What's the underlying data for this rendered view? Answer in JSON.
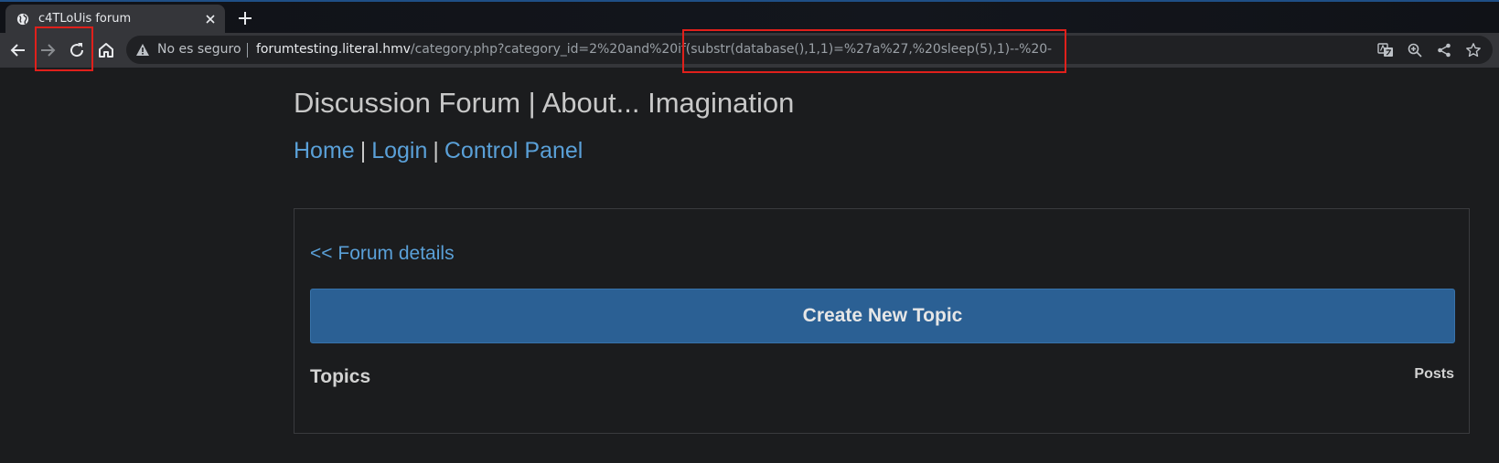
{
  "browser": {
    "tab": {
      "title": "c4TLoUis forum",
      "favicon": "globe-icon",
      "close_icon": "close-icon"
    },
    "new_tab_icon": "plus-icon",
    "toolbar": {
      "back_icon": "arrow-left-icon",
      "forward_icon": "arrow-right-icon",
      "reload_icon": "reload-icon",
      "home_icon": "home-icon"
    },
    "omnibox": {
      "security_icon": "warning-triangle-icon",
      "security_label": "No es seguro",
      "url_host": "forumtesting.literal.hmv",
      "url_path": "/category.php?category_id=2%20and%20if(substr(database(),1,1)=%27a%27,%20sleep(5),1)--%20-",
      "right_icons": [
        "translate-icon",
        "zoom-icon",
        "share-icon",
        "bookmark-star-icon"
      ]
    },
    "annotation_color": "#e0201b"
  },
  "page": {
    "title": "Discussion Forum | About... Imagination",
    "nav": {
      "home": "Home",
      "login": "Login",
      "control_panel": "Control Panel",
      "separator": "|"
    },
    "back_link": "<< Forum details",
    "create_button": "Create New Topic",
    "topics_header": "Topics",
    "posts_header": "Posts"
  },
  "colors": {
    "background": "#1b1c1e",
    "link": "#5aa0d8",
    "button": "#2b6094"
  }
}
